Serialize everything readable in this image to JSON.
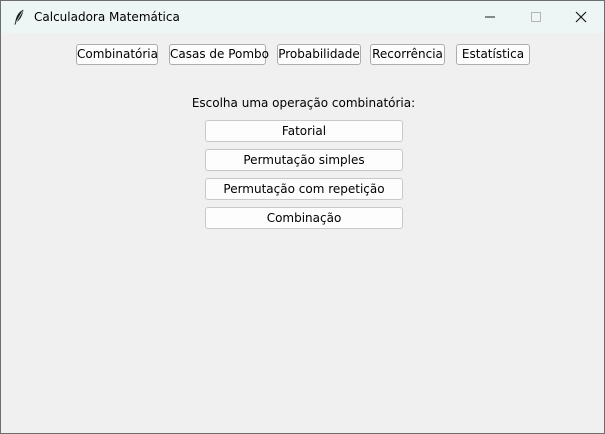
{
  "window": {
    "title": "Calculadora Matemática",
    "icon": "feather-icon",
    "controls": [
      "minimize-icon",
      "maximize-icon",
      "close-icon"
    ]
  },
  "nav": {
    "buttons": [
      {
        "label": "Combinatória"
      },
      {
        "label": "Casas de Pombo"
      },
      {
        "label": "Probabilidade"
      },
      {
        "label": "Recorrência"
      },
      {
        "label": "Estatística"
      }
    ]
  },
  "main": {
    "prompt": "Escolha uma operação combinatória:",
    "operations": [
      {
        "label": "Fatorial"
      },
      {
        "label": "Permutação simples"
      },
      {
        "label": "Permutação com repetição"
      },
      {
        "label": "Combinação"
      }
    ]
  },
  "colors": {
    "titlebar": "#eef6f5",
    "background": "#f0f0f0",
    "button_border": "#adadad"
  }
}
